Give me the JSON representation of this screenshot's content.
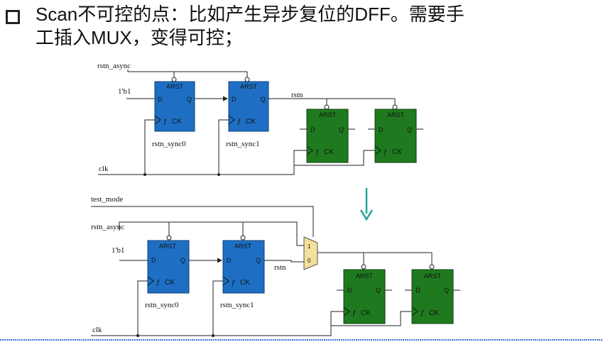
{
  "heading": {
    "line1": "Scan不可控的点：比如产生异步复位的DFF。需要手",
    "line2": "工插入MUX，变得可控；"
  },
  "top_circuit": {
    "rstn_async": "rstn_async",
    "one_b1": "1'b1",
    "rstn": "rstn",
    "clk": "clk",
    "sync0": "rstn_sync0",
    "sync1": "rstn_sync1"
  },
  "bottom_circuit": {
    "test_mode": "test_mode",
    "rstn_async": "rstn_async",
    "one_b1": "1'b1",
    "rstn": "rstn",
    "clk": "clk",
    "sync0": "rstn_sync0",
    "sync1": "rstn_sync1"
  },
  "flop": {
    "arst": "ARST",
    "d": "D",
    "q": "Q",
    "ck": "CK",
    "f": "ƒ"
  },
  "mux": {
    "in1": "1",
    "in0": "0"
  },
  "colors": {
    "sync_flop": "#1e6fc4",
    "data_flop": "#1f7a1f",
    "mux": "#f3e09a",
    "arrow": "#1ea39a",
    "bottom_rule": "#3a6fd8"
  }
}
